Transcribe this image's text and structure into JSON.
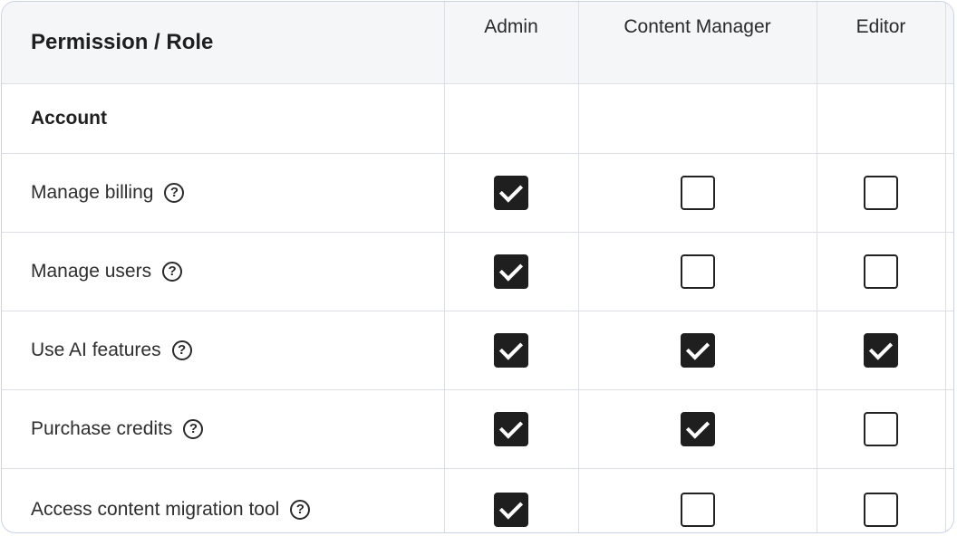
{
  "header": {
    "title": "Permission / Role",
    "roles": [
      "Admin",
      "Content Manager",
      "Editor"
    ]
  },
  "section": {
    "title": "Account"
  },
  "permissions": [
    {
      "label": "Manage billing",
      "admin": true,
      "content_manager": false,
      "editor": false
    },
    {
      "label": "Manage users",
      "admin": true,
      "content_manager": false,
      "editor": false
    },
    {
      "label": "Use AI features",
      "admin": true,
      "content_manager": true,
      "editor": true
    },
    {
      "label": "Purchase credits",
      "admin": true,
      "content_manager": true,
      "editor": false
    },
    {
      "label": "Access content migration tool",
      "admin": true,
      "content_manager": false,
      "editor": false
    }
  ],
  "icons": {
    "help": "question-circle-icon",
    "checked": "checkbox-checked-icon",
    "unchecked": "checkbox-unchecked-icon"
  },
  "colors": {
    "border": "#c9d3e6",
    "header_bg": "#f5f6f7",
    "checked": "#1f1f1f"
  }
}
